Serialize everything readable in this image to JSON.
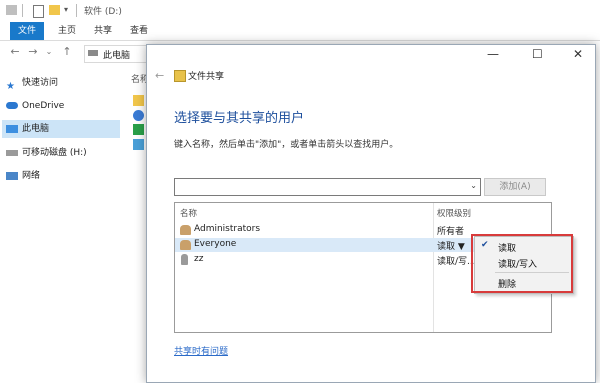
{
  "explorer": {
    "title": "软件 (D:)",
    "ribbon_tabs": [
      "文件",
      "主页",
      "共享",
      "查看"
    ],
    "address_path": "此电脑",
    "sidebar_items": [
      "快速访问",
      "OneDrive",
      "此电脑",
      "可移动磁盘 (H:)",
      "网络"
    ],
    "column_header": "名称"
  },
  "dialog": {
    "title": "文件共享",
    "heading": "选择要与其共享的用户",
    "instruction": "键入名称，然后单击\"添加\"，或者单击箭头以查找用户。",
    "combo_value": "",
    "add_button": "添加(A)",
    "columns": {
      "name": "名称",
      "permission": "权限级别"
    },
    "rows": [
      {
        "name": "Administrators",
        "permission": "所有者"
      },
      {
        "name": "Everyone",
        "permission": "读取 ▼"
      },
      {
        "name": "zz",
        "permission": "读取/写..."
      }
    ],
    "help_link": "共享时有问题",
    "controls": {
      "minimize": "—",
      "maximize": "☐",
      "close": "✕"
    }
  },
  "context_menu": {
    "items": [
      {
        "label": "读取",
        "checked": true
      },
      {
        "label": "读取/写入",
        "checked": false
      },
      {
        "label": "删除",
        "checked": false
      }
    ]
  },
  "colors": {
    "accent": "#1979ca",
    "heading": "#1c4e9c",
    "highlight_border": "#d83b3b"
  }
}
